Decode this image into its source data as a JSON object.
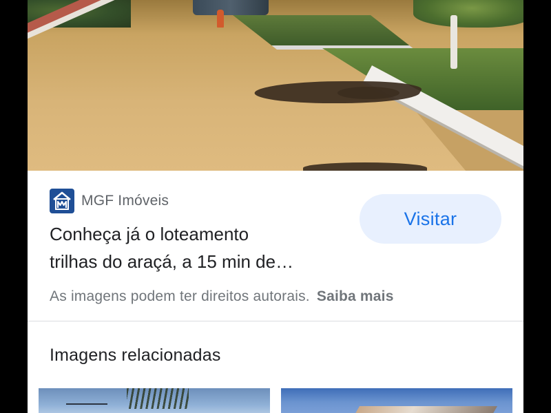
{
  "source": {
    "site_name": "MGF Imóveis",
    "logo_icon": "house-m-logo-icon",
    "logo_color": "#1f4f96"
  },
  "result": {
    "title_line1": "Conheça já o loteamento",
    "title_line2": "trilhas do araçá, a 15 min de…"
  },
  "visit_button": {
    "label": "Visitar",
    "bg_color": "#e8f0fe",
    "text_color": "#1a73e8"
  },
  "copyright": {
    "text": "As imagens podem ter direitos autorais.",
    "learn_more": "Saiba mais"
  },
  "related": {
    "heading": "Imagens relacionadas"
  }
}
